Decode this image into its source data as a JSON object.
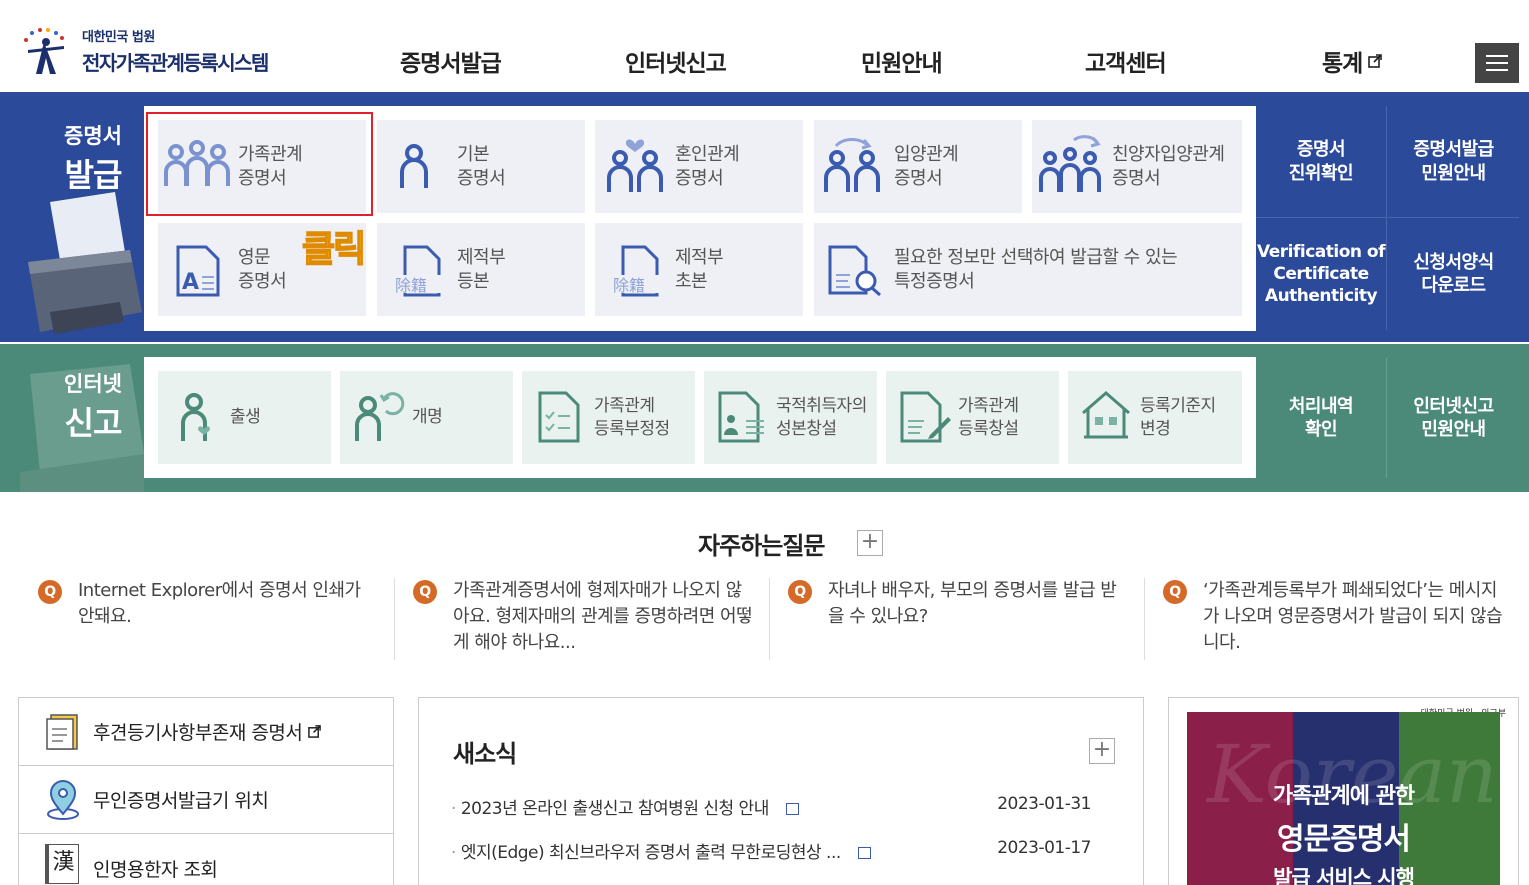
{
  "header": {
    "logo_sub": "대한민국 법원",
    "logo_main": "전자가족관계등록시스템",
    "nav": [
      "증명서발급",
      "인터넷신고",
      "민원안내",
      "고객센터",
      "통계"
    ]
  },
  "certificates": {
    "title_small": "증명서",
    "title_big": "발급",
    "tiles": [
      {
        "line1": "가족관계",
        "line2": "증명서"
      },
      {
        "line1": "기본",
        "line2": "증명서"
      },
      {
        "line1": "혼인관계",
        "line2": "증명서"
      },
      {
        "line1": "입양관계",
        "line2": "증명서"
      },
      {
        "line1": "친양자입양관계",
        "line2": "증명서"
      },
      {
        "line1": "영문",
        "line2": "증명서"
      },
      {
        "line1": "제적부",
        "line2": "등본"
      },
      {
        "line1": "제적부",
        "line2": "초본"
      },
      {
        "line1": "필요한 정보만 선택하여 발급할 수 있는",
        "line2": "특정증명서"
      }
    ],
    "links": [
      {
        "line1": "증명서",
        "line2": "진위확인",
        "line3": ""
      },
      {
        "line1": "증명서발급",
        "line2": "민원안내",
        "line3": ""
      },
      {
        "line1": "Verification of",
        "line2": "Certificate",
        "line3": "Authenticity"
      },
      {
        "line1": "신청서양식",
        "line2": "다운로드",
        "line3": ""
      }
    ],
    "annotation": "클릭",
    "seal_text": "除籍"
  },
  "report": {
    "title_small": "인터넷",
    "title_big": "신고",
    "tiles": [
      {
        "line1": "출생",
        "line2": ""
      },
      {
        "line1": "개명",
        "line2": ""
      },
      {
        "line1": "가족관계",
        "line2": "등록부정정"
      },
      {
        "line1": "국적취득자의",
        "line2": "성본창설"
      },
      {
        "line1": "가족관계",
        "line2": "등록창설"
      },
      {
        "line1": "등록기준지",
        "line2": "변경"
      }
    ],
    "links": [
      {
        "line1": "처리내역",
        "line2": "확인"
      },
      {
        "line1": "인터넷신고",
        "line2": "민원안내"
      }
    ]
  },
  "faq": {
    "title": "자주하는질문",
    "more": "+",
    "q_badge": "Q",
    "items": [
      "Internet Explorer에서 증명서 인쇄가 안돼요.",
      "가족관계증명서에 형제자매가 나오지 않아요. 형제자매의 관계를 증명하려면 어떻게 해야 하나요...",
      "자녀나 배우자, 부모의 증명서를 발급 받을 수 있나요?",
      "‘가족관계등록부가 폐쇄되었다’는 메시지가 나오며 영문증명서가 발급이 되지 않습니다."
    ]
  },
  "quick_links": [
    "후견등기사항부존재 증명서",
    "무인증명서발급기 위치",
    "인명용한자 조회"
  ],
  "quick_icon_text": "漢",
  "news": {
    "title": "새소식",
    "more": "+",
    "items": [
      {
        "title": "2023년 온라인 출생신고 참여병원 신청 안내",
        "date": "2023-01-31"
      },
      {
        "title": "엣지(Edge) 최신브라우저 증명서 출력 무한로딩현상 ...",
        "date": "2023-01-17"
      }
    ]
  },
  "banner": {
    "brand_court": "대한민국 법원",
    "brand_ministry": "외교부",
    "watermark": "Korean",
    "line1": "가족관계에 관한",
    "line2": "영문증명서",
    "line3": "발급 서비스 시행"
  },
  "colors": {
    "cert_band": "#2c4a9a",
    "report_band": "#4b8a78",
    "tile_bg": "#eef0f5",
    "icon_blue": "#3a5bb0",
    "icon_green": "#4b8a78",
    "highlight": "#e0202c",
    "faq_badge": "#d56a28"
  }
}
